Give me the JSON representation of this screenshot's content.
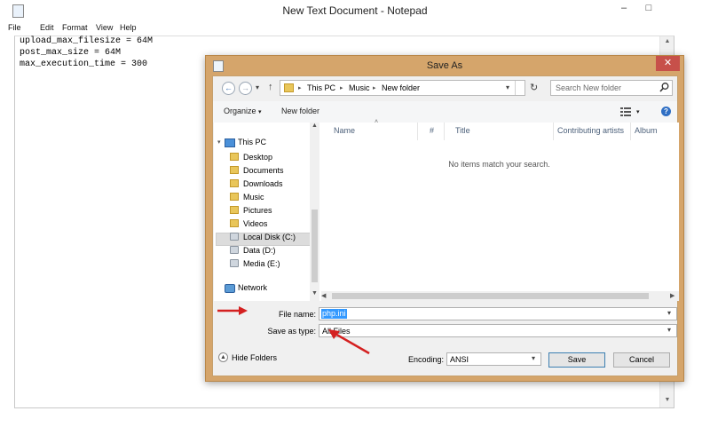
{
  "notepad": {
    "title": "New Text Document - Notepad",
    "caption": {
      "minimize": "–",
      "maximize": "□"
    },
    "menu": [
      "File",
      "Edit",
      "Format",
      "View",
      "Help"
    ],
    "lines": [
      "upload_max_filesize = 64M",
      "post_max_size = 64M",
      "max_execution_time = 300"
    ]
  },
  "dialog": {
    "title": "Save As",
    "close": "✕",
    "nav": {
      "back": "←",
      "forward": "→",
      "recent": "▾",
      "up": "↑",
      "breadcrumb": [
        "This PC",
        "Music",
        "New folder"
      ],
      "separator": "▸",
      "refresh": "↻",
      "search_placeholder": "Search New folder"
    },
    "toolbar": {
      "organize": "Organize",
      "new_folder": "New folder",
      "help": "?"
    },
    "tree": {
      "this_pc": "This PC",
      "items": [
        {
          "label": "Desktop",
          "icon": "folder-icon"
        },
        {
          "label": "Documents",
          "icon": "folder-icon"
        },
        {
          "label": "Downloads",
          "icon": "folder-icon"
        },
        {
          "label": "Music",
          "icon": "folder-icon"
        },
        {
          "label": "Pictures",
          "icon": "folder-icon"
        },
        {
          "label": "Videos",
          "icon": "folder-icon"
        },
        {
          "label": "Local Disk (C:)",
          "icon": "drive-icon"
        },
        {
          "label": "Data (D:)",
          "icon": "drive-icon"
        },
        {
          "label": "Media (E:)",
          "icon": "drive-icon"
        }
      ],
      "network": "Network",
      "selected": "Music"
    },
    "columns": [
      "Name",
      "#",
      "Title",
      "Contributing artists",
      "Album"
    ],
    "empty_message": "No items match your search.",
    "form": {
      "file_name_label": "File name:",
      "file_name_value": "php.ini",
      "save_type_label": "Save as type:",
      "save_type_value": "All Files",
      "encoding_label": "Encoding:",
      "encoding_value": "ANSI",
      "hide_folders": "Hide Folders",
      "save": "Save",
      "cancel": "Cancel"
    }
  },
  "colors": {
    "dialog_frame": "#d5a56b",
    "close_button": "#c7504a",
    "selection": "#3399ff",
    "annotation_arrow": "#d42020"
  }
}
